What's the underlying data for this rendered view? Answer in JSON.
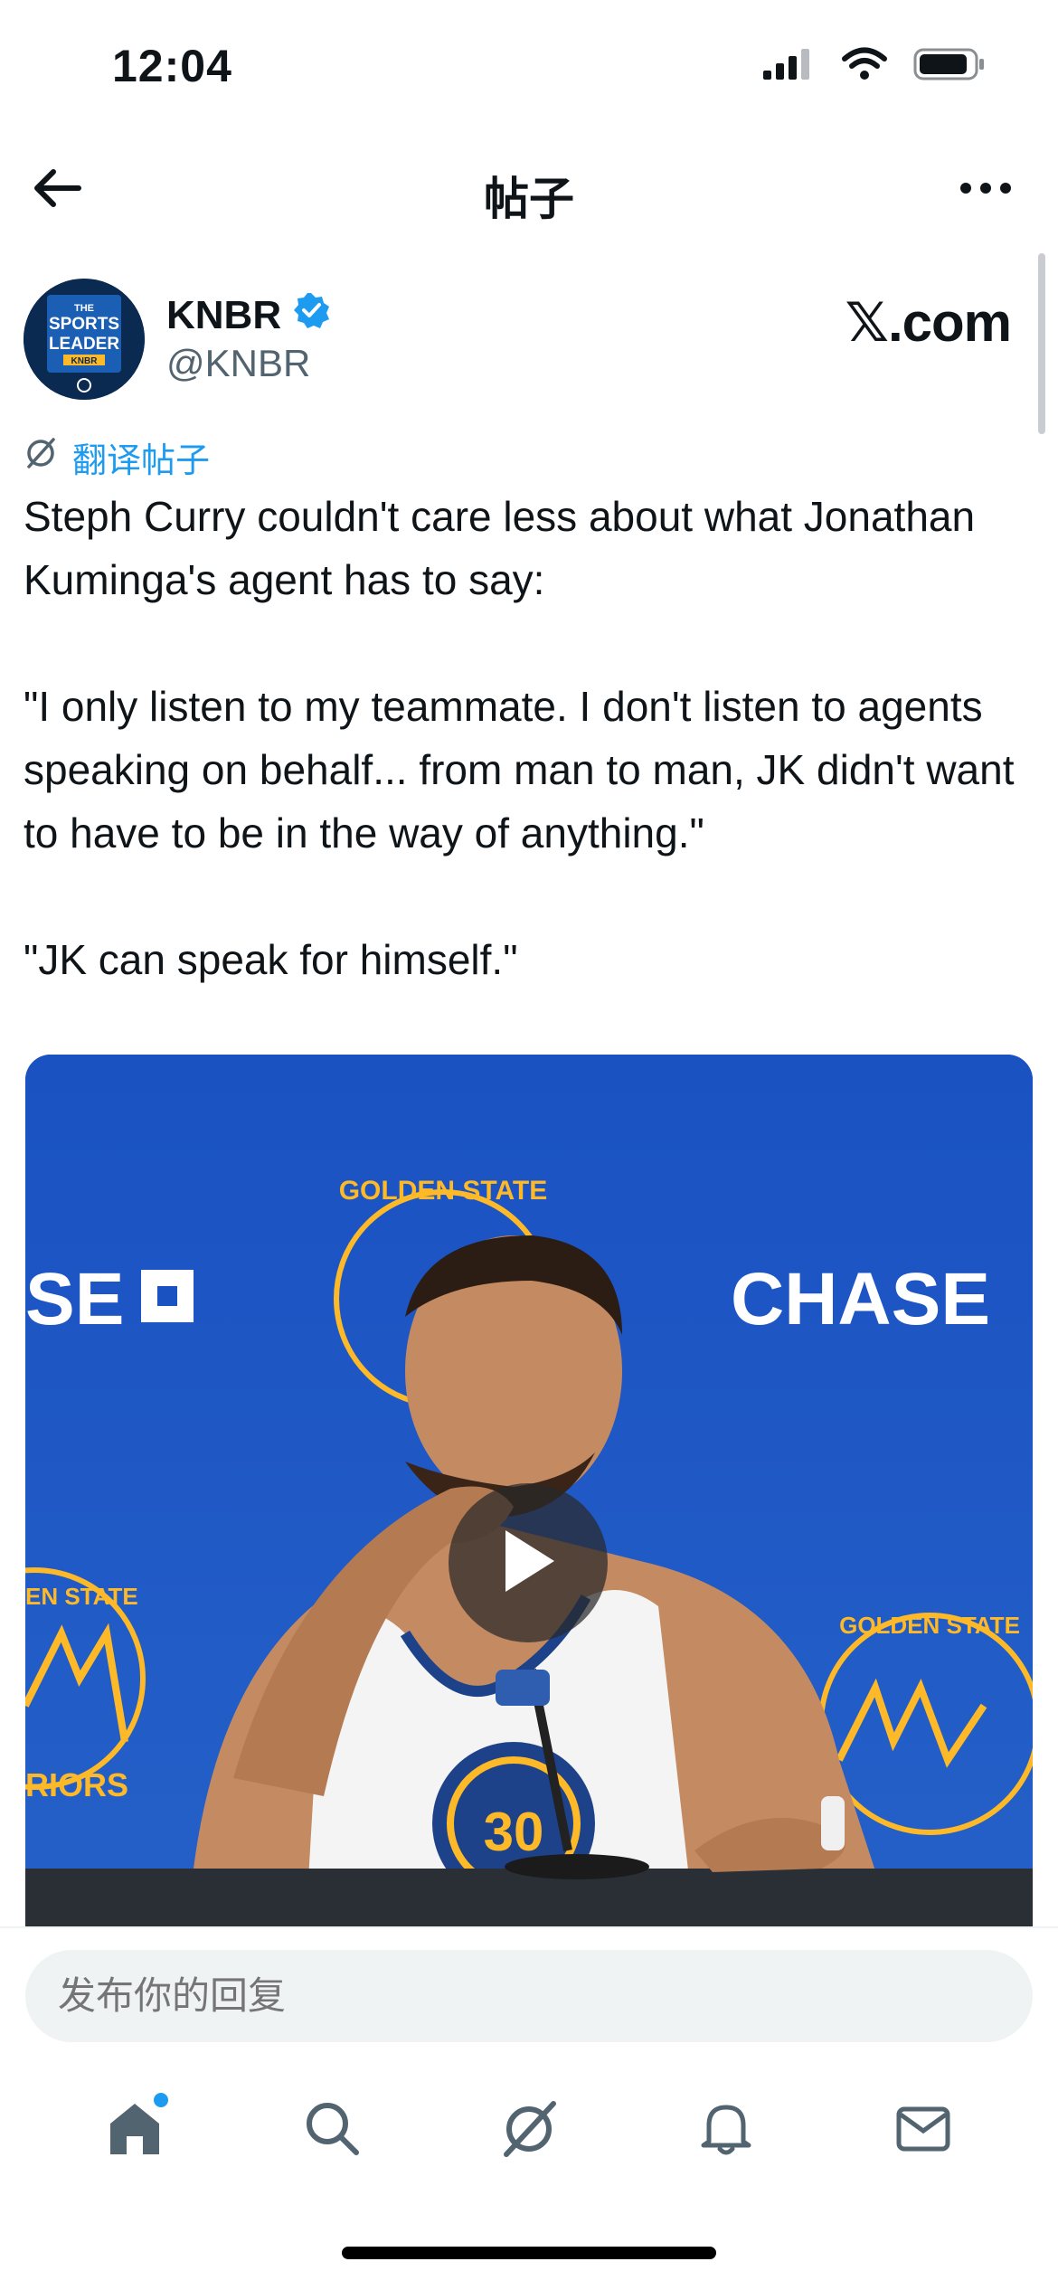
{
  "status_bar": {
    "time": "12:04",
    "icons": [
      "cellular-signal-icon",
      "wifi-icon",
      "battery-icon"
    ]
  },
  "nav": {
    "title": "帖子",
    "back_icon": "arrow-left-icon",
    "more_icon": "more-horizontal-icon"
  },
  "post": {
    "author": {
      "name": "KNBR",
      "handle": "@KNBR",
      "verified": true,
      "avatar_text": [
        "THE",
        "SPORTS",
        "LEADER",
        "KNBR"
      ]
    },
    "source_label": "𝕏.com",
    "translate_label": "翻译帖子",
    "paragraphs": [
      "Steph Curry couldn't care less about what Jonathan Kuminga's agent has to say:",
      "\"I only listen to my teammate. I don't listen to agents speaking on behalf... from man to man, JK didn't want to have to be in the way of anything.\"",
      "\"JK can speak for himself.\""
    ],
    "video": {
      "backdrop_text_left": "SE",
      "backdrop_text_right": "CHASE",
      "logo_text": "GOLDEN STATE",
      "logo_text_left": "EN STATE",
      "logo_text_left_bottom": "RIORS",
      "jersey_number": "30",
      "play_icon": "play-icon"
    }
  },
  "reply": {
    "placeholder": "发布你的回复"
  },
  "tabs": [
    {
      "name": "home",
      "icon": "home-icon",
      "has_dot": true
    },
    {
      "name": "search",
      "icon": "search-icon",
      "has_dot": false
    },
    {
      "name": "grok",
      "icon": "grok-icon",
      "has_dot": false
    },
    {
      "name": "notifications",
      "icon": "bell-icon",
      "has_dot": false
    },
    {
      "name": "messages",
      "icon": "mail-icon",
      "has_dot": false
    }
  ],
  "colors": {
    "accent": "#1d9bf0",
    "text": "#0f1419",
    "secondary": "#536471",
    "video_bg": "#1f55c3",
    "warriors_gold": "#fdb927"
  }
}
